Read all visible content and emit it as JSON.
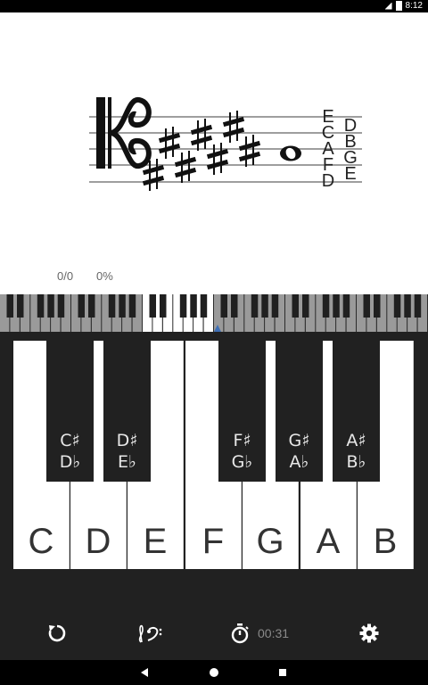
{
  "status_bar": {
    "time": "8:12",
    "icons": [
      "wifi-off-icon",
      "signal-icon",
      "battery-icon"
    ]
  },
  "staff": {
    "clef": "alto-clef",
    "key_signature_sharps": 7,
    "note": "whole-note",
    "line_names_left": [
      "E",
      "C",
      "A",
      "F",
      "D"
    ],
    "line_names_right": [
      "D",
      "B",
      "G",
      "E"
    ]
  },
  "stats": {
    "score": "0/0",
    "percent": "0%"
  },
  "keyboard": {
    "white_keys": [
      "C",
      "D",
      "E",
      "F",
      "G",
      "A",
      "B"
    ],
    "black_keys": [
      {
        "sharp": "C♯",
        "flat": "D♭"
      },
      {
        "sharp": "D♯",
        "flat": "E♭"
      },
      {
        "sharp": "F♯",
        "flat": "G♭"
      },
      {
        "sharp": "G♯",
        "flat": "A♭"
      },
      {
        "sharp": "A♯",
        "flat": "B♭"
      }
    ]
  },
  "toolbar": {
    "reset_icon": "reset-icon",
    "clef_icon": "clef-switch-icon",
    "timer_icon": "stopwatch-icon",
    "timer": "00:31",
    "settings_icon": "settings-icon"
  },
  "nav_bar": {
    "items": [
      "back-icon",
      "home-icon",
      "recents-icon"
    ]
  },
  "colors": {
    "key_dark": "#212121",
    "highlight": "#3f6fb5"
  }
}
